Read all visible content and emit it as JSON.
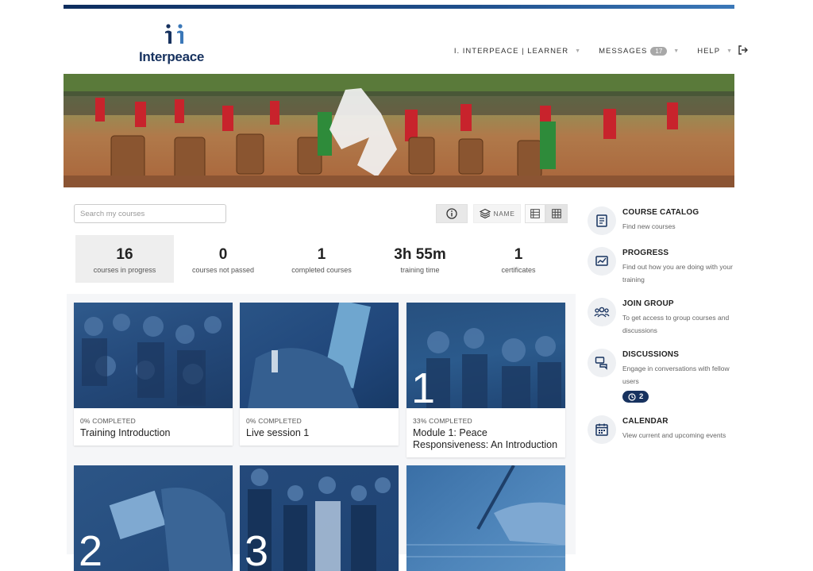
{
  "brand": {
    "name": "Interpeace",
    "color": "#17325f",
    "accent": "#3b78b8"
  },
  "nav": {
    "user": "I. INTERPEACE | LEARNER",
    "messages": "MESSAGES",
    "messages_count": "17",
    "help": "HELP",
    "logout_icon": "logout-icon"
  },
  "search": {
    "placeholder": "Search my courses",
    "value": ""
  },
  "toolbar": {
    "info_icon": "info-icon",
    "sort_label": "NAME",
    "list_icon": "list-view-icon",
    "grid_icon": "grid-view-icon"
  },
  "stats": [
    {
      "value": "16",
      "label": "courses in progress"
    },
    {
      "value": "0",
      "label": "courses not passed"
    },
    {
      "value": "1",
      "label": "completed courses"
    },
    {
      "value": "3h 55m",
      "label": "training time"
    },
    {
      "value": "1",
      "label": "certificates"
    }
  ],
  "courses": [
    {
      "progress": "0% COMPLETED",
      "title": "Training Introduction",
      "number": ""
    },
    {
      "progress": "0% COMPLETED",
      "title": "Live session 1",
      "number": ""
    },
    {
      "progress": "33% COMPLETED",
      "title": "Module 1: Peace Responsiveness: An Introduction",
      "number": "1"
    },
    {
      "progress": "",
      "title": "",
      "number": "2"
    },
    {
      "progress": "",
      "title": "",
      "number": "3"
    },
    {
      "progress": "",
      "title": "",
      "number": ""
    }
  ],
  "sidebar": [
    {
      "title": "COURSE CATALOG",
      "desc": "Find new courses",
      "icon": "book-icon"
    },
    {
      "title": "PROGRESS",
      "desc": "Find out how you are doing with your training",
      "icon": "progress-chart-icon"
    },
    {
      "title": "JOIN GROUP",
      "desc": "To get access to group courses and discussions",
      "icon": "group-icon"
    },
    {
      "title": "DISCUSSIONS",
      "desc": "Engage in conversations with fellow users",
      "icon": "chat-bubbles-icon",
      "badge": "2"
    },
    {
      "title": "CALENDAR",
      "desc": "View current and upcoming events",
      "icon": "calendar-icon"
    }
  ]
}
